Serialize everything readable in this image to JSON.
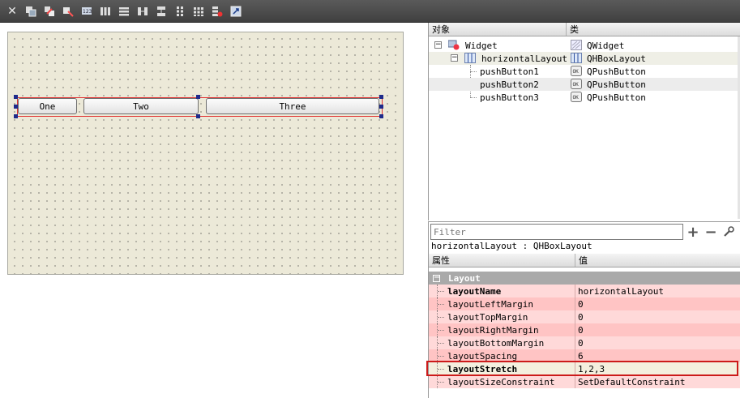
{
  "toolbar": {
    "items": [
      "close-icon",
      "edit-widgets-icon",
      "edit-signals-slots-icon",
      "edit-buddies-icon",
      "edit-tab-order-icon",
      "layout-horizontal-icon",
      "layout-vertical-icon",
      "layout-horizontal-splitter-icon",
      "layout-vertical-splitter-icon",
      "layout-form-icon",
      "layout-grid-icon",
      "break-layout-icon",
      "adjust-size-icon"
    ]
  },
  "form": {
    "buttons": [
      {
        "label": "One"
      },
      {
        "label": "Two"
      },
      {
        "label": "Three"
      }
    ]
  },
  "object_inspector": {
    "col_object": "对象",
    "col_class": "类",
    "rows": [
      {
        "name": "Widget",
        "class": "QWidget",
        "icon": "widget-icon",
        "class_icon": "qwidget-icon"
      },
      {
        "name": "horizontalLayout",
        "class": "QHBoxLayout",
        "icon": "hbox-layout-icon",
        "class_icon": "hbox-layout-icon"
      },
      {
        "name": "pushButton1",
        "class": "QPushButton",
        "class_icon": "pushbutton-icon"
      },
      {
        "name": "pushButton2",
        "class": "QPushButton",
        "class_icon": "pushbutton-icon"
      },
      {
        "name": "pushButton3",
        "class": "QPushButton",
        "class_icon": "pushbutton-icon"
      }
    ]
  },
  "filter": {
    "placeholder": "Filter",
    "add_label": "+",
    "remove_label": "−"
  },
  "property_editor": {
    "title": "horizontalLayout : QHBoxLayout",
    "col_property": "属性",
    "col_value": "值",
    "group": "Layout",
    "group_toggle": "−",
    "rows": [
      {
        "name": "layoutName",
        "value": "horizontalLayout",
        "bold": true
      },
      {
        "name": "layoutLeftMargin",
        "value": "0"
      },
      {
        "name": "layoutTopMargin",
        "value": "0"
      },
      {
        "name": "layoutRightMargin",
        "value": "0"
      },
      {
        "name": "layoutBottomMargin",
        "value": "0"
      },
      {
        "name": "layoutSpacing",
        "value": "6"
      },
      {
        "name": "layoutStretch",
        "value": "1,2,3",
        "bold": true
      },
      {
        "name": "layoutSizeConstraint",
        "value": "SetDefaultConstraint"
      }
    ],
    "row_colors": {
      "pink": "#ffd3d3",
      "pink_alt": "#ffbcbc",
      "selected": "#f2ecd8"
    }
  }
}
